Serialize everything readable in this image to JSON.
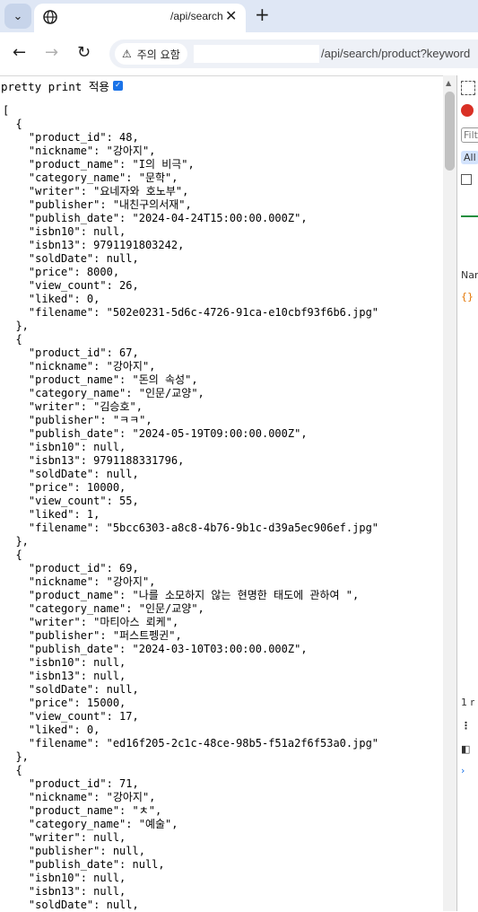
{
  "tab": {
    "title": "/api/search"
  },
  "address": {
    "security_chip": "주의 요함",
    "url": "/api/search/product?keyword"
  },
  "pretty_print": {
    "label": "pretty print 적용",
    "checked": true
  },
  "products": [
    {
      "product_id": 48,
      "nickname": "강아지",
      "product_name": "I의 비극",
      "category_name": "문학",
      "writer": "요네자와 호노부",
      "publisher": "내친구의서재",
      "publish_date": "2024-04-24T15:00:00.000Z",
      "isbn10": null,
      "isbn13": 9791191803242,
      "soldDate": null,
      "price": 8000,
      "view_count": 26,
      "liked": 0,
      "filename": "502e0231-5d6c-4726-91ca-e10cbf93f6b6.jpg"
    },
    {
      "product_id": 67,
      "nickname": "강아지",
      "product_name": "돈의 속성",
      "category_name": "인문/교양",
      "writer": "김승호",
      "publisher": "ㅋㅋ",
      "publish_date": "2024-05-19T09:00:00.000Z",
      "isbn10": null,
      "isbn13": 9791188331796,
      "soldDate": null,
      "price": 10000,
      "view_count": 55,
      "liked": 1,
      "filename": "5bcc6303-a8c8-4b76-9b1c-d39a5ec906ef.jpg"
    },
    {
      "product_id": 69,
      "nickname": "강아지",
      "product_name": "나를 소모하지 않는 현명한 태도에 관하여 ",
      "category_name": "인문/교양",
      "writer": "마티아스 뢰케",
      "publisher": "퍼스트펭귄",
      "publish_date": "2024-03-10T03:00:00.000Z",
      "isbn10": null,
      "isbn13": null,
      "soldDate": null,
      "price": 15000,
      "view_count": 17,
      "liked": 0,
      "filename": "ed16f205-2c1c-48ce-98b5-f51a2f6f53a0.jpg"
    },
    {
      "product_id": 71,
      "nickname": "강아지",
      "product_name": "ㅊ",
      "category_name": "예술",
      "writer": null,
      "publisher": null,
      "publish_date": null,
      "isbn10": null,
      "isbn13": null,
      "soldDate": null
    }
  ],
  "devtools": {
    "filter": "Filt",
    "all": "All",
    "name_col": "Nan",
    "count": "1 r"
  },
  "colors": {
    "tabstrip": "#dfe7f5",
    "checkbox": "#1a73e8",
    "devtools_red": "#d93025",
    "devtools_orange": "#e37400"
  }
}
